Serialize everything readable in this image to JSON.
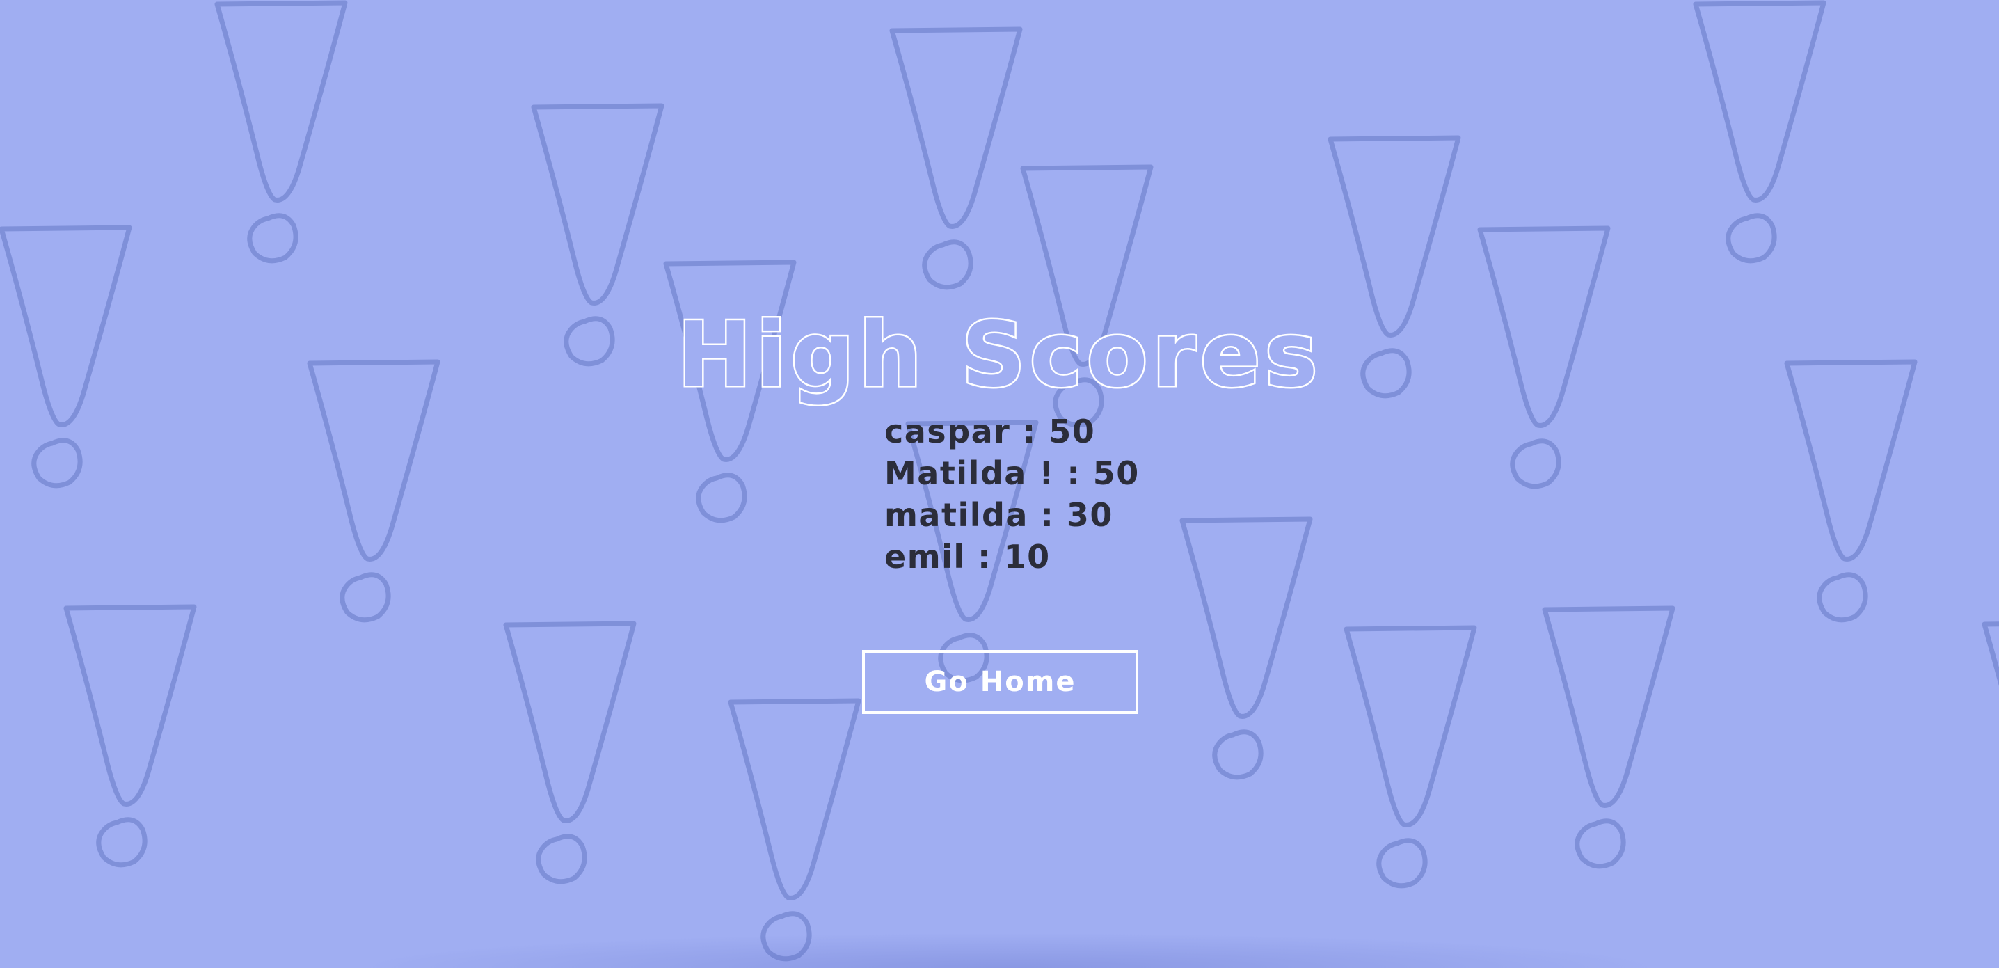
{
  "page": {
    "title": "High Scores",
    "background_color": "#a0aef2",
    "pattern_color": "#7f90d9",
    "title_stroke_color": "#ffffff",
    "text_color": "#2b2d3a"
  },
  "scores": [
    {
      "label": "caspar : 50"
    },
    {
      "label": "Matilda ! : 50"
    },
    {
      "label": "matilda : 30"
    },
    {
      "label": "emil : 10"
    }
  ],
  "actions": {
    "go_home_label": "Go Home"
  },
  "background": {
    "icon": "exclamation-mark-icon"
  }
}
